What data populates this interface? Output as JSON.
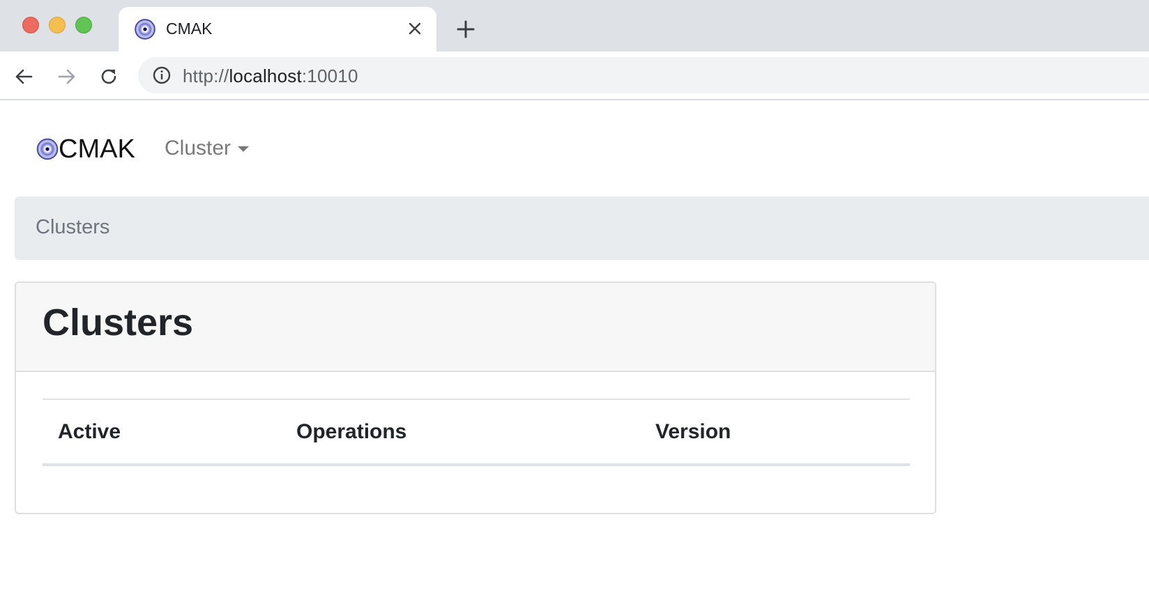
{
  "browser": {
    "tab": {
      "title": "CMAK",
      "favicon": "cmak-logo-icon"
    },
    "address_bar": {
      "scheme": "http://",
      "host": "localhost",
      "port": ":10010"
    },
    "icons": {
      "back": "arrow-left-icon",
      "forward": "arrow-right-icon",
      "reload": "reload-icon",
      "info": "info-icon",
      "close": "close-icon",
      "new_tab": "plus-icon"
    }
  },
  "navbar": {
    "brand": "CMAK",
    "dropdown_label": "Cluster"
  },
  "breadcrumb": {
    "items": [
      "Clusters"
    ]
  },
  "card": {
    "title": "Clusters",
    "table": {
      "columns": [
        "Active",
        "Operations",
        "Version"
      ],
      "rows": []
    }
  },
  "colors": {
    "tabstrip_bg": "#dee1e6",
    "breadcrumb_bg": "#e9ecef",
    "card_header_bg": "#f7f7f7",
    "text_dark": "#212529",
    "text_muted": "#6c757d",
    "logo_ring": "#5a5fc0"
  }
}
